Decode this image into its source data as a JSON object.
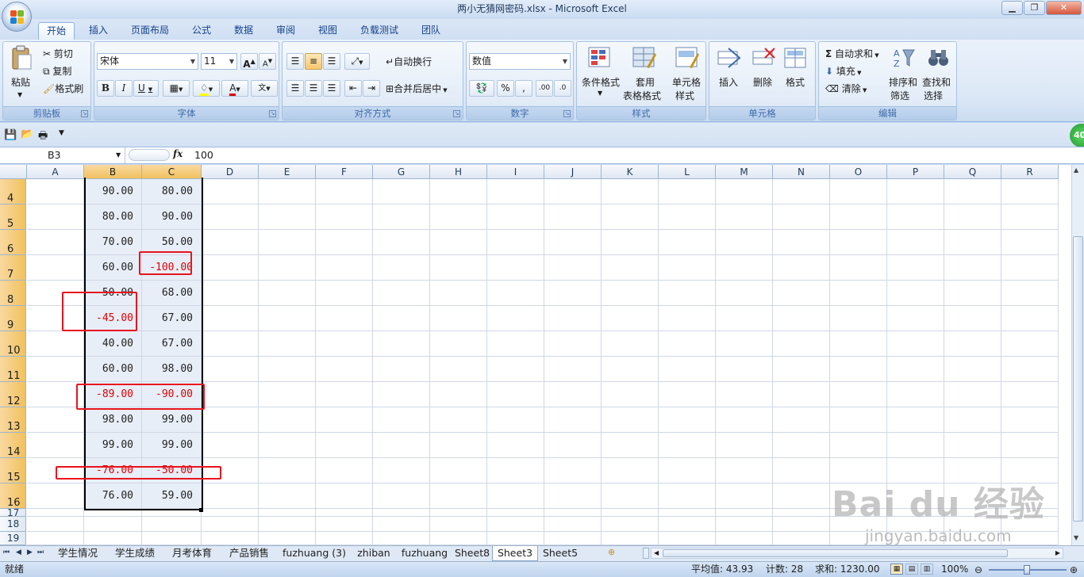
{
  "window": {
    "title": "两小无猜网密码.xlsx - Microsoft Excel"
  },
  "ribbon_tabs": [
    "开始",
    "插入",
    "页面布局",
    "公式",
    "数据",
    "审阅",
    "视图",
    "负载测试",
    "团队"
  ],
  "clipboard": {
    "paste": "粘贴",
    "cut": "剪切",
    "copy": "复制",
    "format_painter": "格式刷",
    "title": "剪贴板"
  },
  "font": {
    "name": "宋体",
    "size": "11",
    "title": "字体"
  },
  "alignment": {
    "wrap": "自动换行",
    "merge": "合并后居中",
    "title": "对齐方式"
  },
  "number": {
    "format": "数值",
    "title": "数字"
  },
  "styles": {
    "cond": "条件格式",
    "table1": "套用",
    "table2": "表格格式",
    "cell1": "单元格",
    "cell2": "样式",
    "title": "样式"
  },
  "cells": {
    "insert": "插入",
    "delete": "删除",
    "format": "格式",
    "title": "单元格"
  },
  "editing": {
    "autosum": "自动求和",
    "fill": "填充",
    "clear": "清除",
    "sort1": "排序和",
    "sort2": "筛选",
    "find1": "查找和",
    "find2": "选择",
    "title": "编辑"
  },
  "formula_bar": {
    "name_box": "B3",
    "fx": "fx",
    "value": "100"
  },
  "columns": [
    "A",
    "B",
    "C",
    "D",
    "E",
    "F",
    "G",
    "H",
    "I",
    "J",
    "K",
    "L",
    "M",
    "N",
    "O",
    "P",
    "Q",
    "R"
  ],
  "rows": [
    {
      "n": "4",
      "b": "90.00",
      "c": "80.00"
    },
    {
      "n": "5",
      "b": "80.00",
      "c": "90.00"
    },
    {
      "n": "6",
      "b": "70.00",
      "c": "50.00"
    },
    {
      "n": "7",
      "b": "60.00",
      "c": "-100.00"
    },
    {
      "n": "8",
      "b": "50.00",
      "c": "68.00"
    },
    {
      "n": "9",
      "b": "-45.00",
      "c": "67.00"
    },
    {
      "n": "10",
      "b": "40.00",
      "c": "67.00"
    },
    {
      "n": "11",
      "b": "60.00",
      "c": "98.00"
    },
    {
      "n": "12",
      "b": "-89.00",
      "c": "-90.00"
    },
    {
      "n": "13",
      "b": "98.00",
      "c": "99.00"
    },
    {
      "n": "14",
      "b": "99.00",
      "c": "99.00"
    },
    {
      "n": "15",
      "b": "-76.00",
      "c": "-50.00"
    },
    {
      "n": "16",
      "b": "76.00",
      "c": "59.00"
    },
    {
      "n": "17",
      "b": "",
      "c": ""
    },
    {
      "n": "18",
      "b": "",
      "c": ""
    },
    {
      "n": "19",
      "b": "",
      "c": ""
    }
  ],
  "sheet_tabs": [
    "学生情况",
    "学生成绩",
    "月考体育",
    "产品销售",
    "fuzhuang (3)",
    "zhiban",
    "fuzhuang",
    "Sheet8",
    "Sheet3",
    "Sheet5"
  ],
  "active_sheet": "Sheet3",
  "status": {
    "ready": "就绪",
    "average": "平均值: 43.93",
    "count": "计数: 28",
    "sum": "求和: 1230.00",
    "zoom": "100%"
  },
  "badge": "40",
  "watermark": {
    "main": "Bai du 经验",
    "sub": "jingyan.baidu.com"
  }
}
